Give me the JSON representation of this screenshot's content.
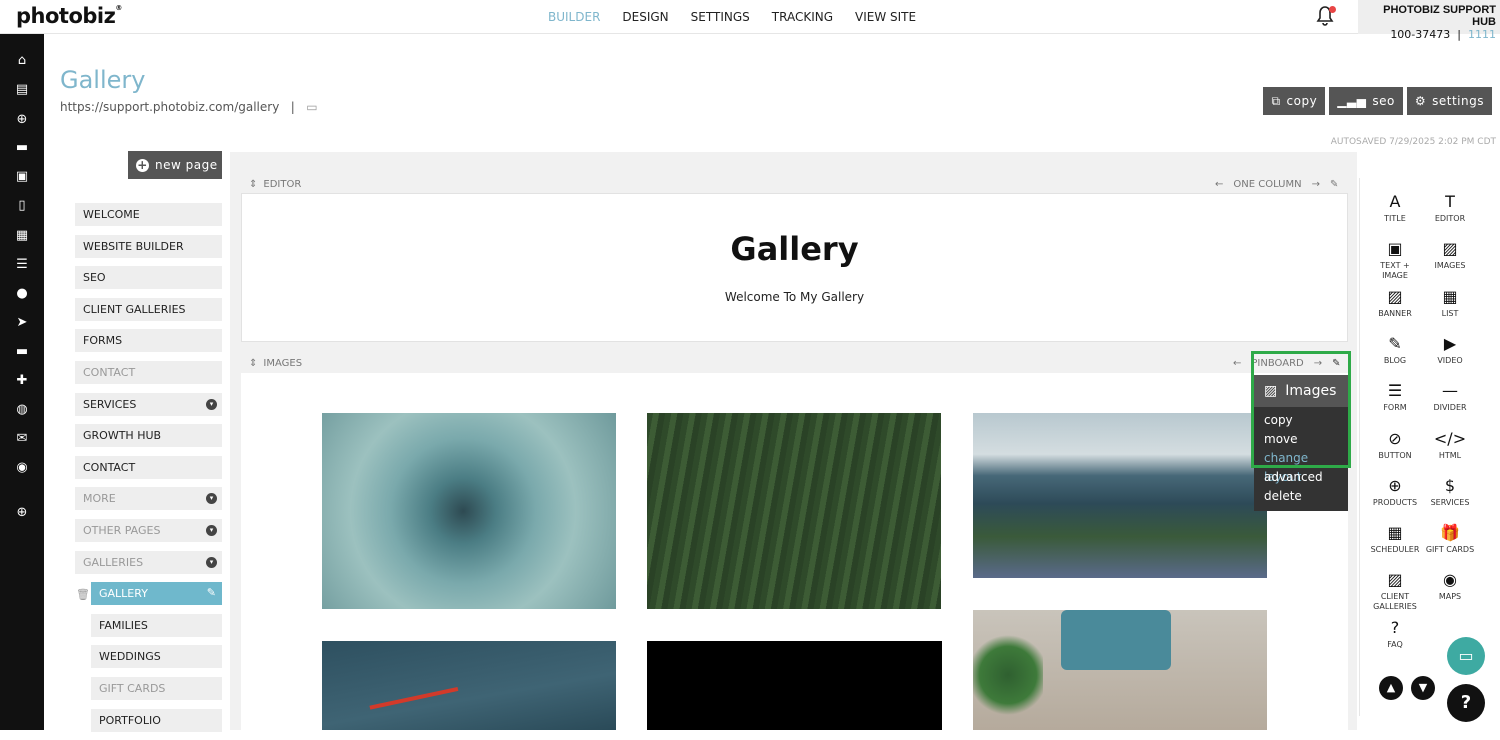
{
  "brand": {
    "logo": "photobiz",
    "accent": "#7fb6cc"
  },
  "topnav": {
    "builder": "BUILDER",
    "design": "DESIGN",
    "settings": "SETTINGS",
    "tracking": "TRACKING",
    "view_site": "VIEW SITE"
  },
  "account": {
    "name": "PHOTOBIZ SUPPORT HUB",
    "id": "100-37473",
    "sep": "|",
    "suffix": "1111"
  },
  "page": {
    "title": "Gallery",
    "url": "https://support.photobiz.com/gallery",
    "url_sep": "|",
    "autosaved": "AUTOSAVED 7/29/2025 2:02 PM CDT"
  },
  "toolbar": {
    "copy": "copy",
    "seo": "seo",
    "settings": "settings",
    "new_page": "new page"
  },
  "pages": [
    {
      "label": "WELCOME",
      "dim": false
    },
    {
      "label": "WEBSITE BUILDER",
      "dim": false
    },
    {
      "label": "SEO",
      "dim": false
    },
    {
      "label": "CLIENT GALLERIES",
      "dim": false
    },
    {
      "label": "FORMS",
      "dim": false
    },
    {
      "label": "CONTACT",
      "dim": true
    },
    {
      "label": "SERVICES",
      "dim": false,
      "toggle": true
    },
    {
      "label": "GROWTH HUB",
      "dim": false
    },
    {
      "label": "CONTACT",
      "dim": false
    },
    {
      "label": "MORE",
      "dim": true,
      "toggle": true
    },
    {
      "label": "OTHER PAGES",
      "dim": true,
      "toggle": true
    },
    {
      "label": "GALLERIES",
      "dim": true,
      "toggle": true
    },
    {
      "label": "GALLERY",
      "active": true,
      "sub": true
    },
    {
      "label": "FAMILIES",
      "sub": true
    },
    {
      "label": "WEDDINGS",
      "sub": true
    },
    {
      "label": "GIFT CARDS",
      "dim": true,
      "sub": true
    },
    {
      "label": "PORTFOLIO",
      "sub": true
    }
  ],
  "sections": {
    "editor": {
      "label": "EDITOR",
      "layout": "ONE COLUMN",
      "heading": "Gallery",
      "text": "Welcome To My Gallery"
    },
    "images": {
      "label": "IMAGES",
      "layout": "PINBOARD"
    }
  },
  "context_menu": {
    "title": "Images",
    "items": [
      "copy",
      "move",
      "change layout",
      "advanced",
      "delete"
    ],
    "active_index": 2
  },
  "widgets": [
    {
      "g": "A",
      "l": "TITLE"
    },
    {
      "g": "T",
      "l": "EDITOR"
    },
    {
      "g": "▣",
      "l": "TEXT + IMAGE"
    },
    {
      "g": "▨",
      "l": "IMAGES"
    },
    {
      "g": "▨",
      "l": "BANNER"
    },
    {
      "g": "▦",
      "l": "LIST"
    },
    {
      "g": "✎",
      "l": "BLOG"
    },
    {
      "g": "▶",
      "l": "VIDEO"
    },
    {
      "g": "☰",
      "l": "FORM"
    },
    {
      "g": "—",
      "l": "DIVIDER"
    },
    {
      "g": "⊘",
      "l": "BUTTON"
    },
    {
      "g": "</>",
      "l": "HTML"
    },
    {
      "g": "⊕",
      "l": "PRODUCTS"
    },
    {
      "g": "$",
      "l": "SERVICES"
    },
    {
      "g": "▦",
      "l": "SCHEDULER"
    },
    {
      "g": "🎁",
      "l": "GIFT CARDS"
    },
    {
      "g": "▨",
      "l": "CLIENT GALLERIES"
    },
    {
      "g": "◉",
      "l": "MAPS"
    },
    {
      "g": "?",
      "l": "FAQ"
    }
  ]
}
